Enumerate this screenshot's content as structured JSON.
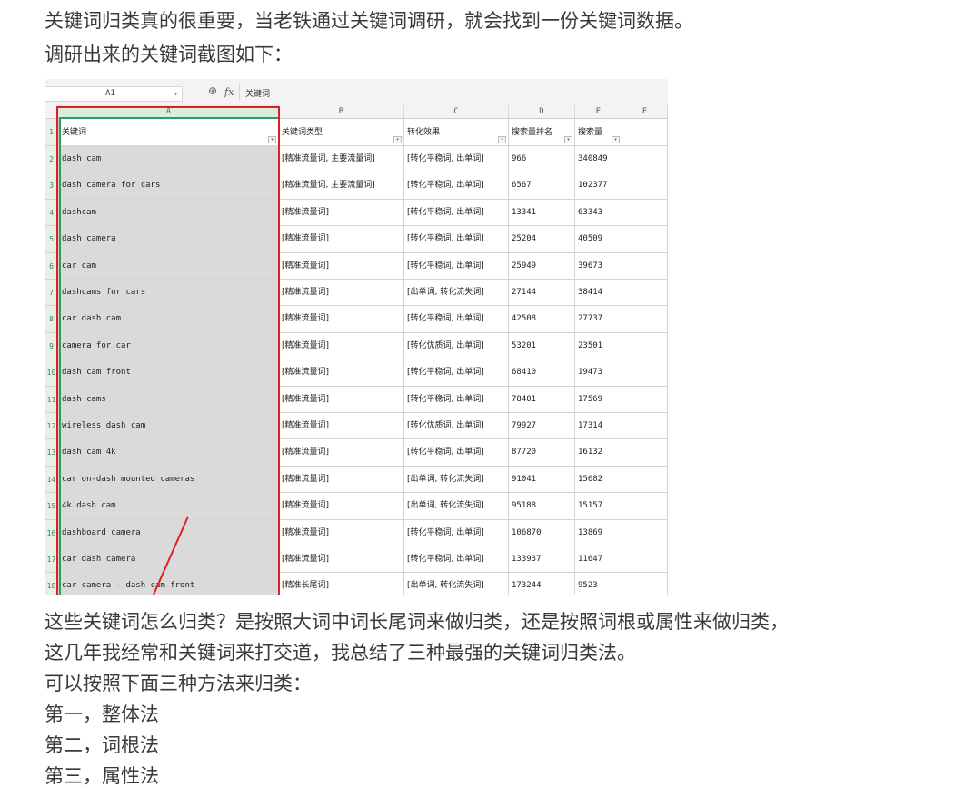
{
  "intro": {
    "line1": "关键词归类真的很重要，当老铁通过关键词调研，就会找到一份关键词数据。",
    "line2": "调研出来的关键词截图如下："
  },
  "spreadsheet": {
    "name_box": "A1",
    "fx_symbol": "fx",
    "formula_content": "关键词",
    "columns": [
      "A",
      "B",
      "C",
      "D",
      "E",
      "F"
    ],
    "headers": [
      "关键词",
      "关键词类型",
      "转化效果",
      "搜索量排名",
      "搜索量"
    ],
    "rows": [
      {
        "n": "1"
      },
      {
        "n": "2",
        "kw": "dash cam",
        "type": "[精准流量词, 主要流量词]",
        "conv": "[转化平稳词, 出单词]",
        "rank": "966",
        "vol": "340849"
      },
      {
        "n": "3",
        "kw": "dash camera for cars",
        "type": "[精准流量词, 主要流量词]",
        "conv": "[转化平稳词, 出单词]",
        "rank": "6567",
        "vol": "102377"
      },
      {
        "n": "4",
        "kw": "dashcam",
        "type": "[精准流量词]",
        "conv": "[转化平稳词, 出单词]",
        "rank": "13341",
        "vol": "63343"
      },
      {
        "n": "5",
        "kw": "dash camera",
        "type": "[精准流量词]",
        "conv": "[转化平稳词, 出单词]",
        "rank": "25204",
        "vol": "40509"
      },
      {
        "n": "6",
        "kw": "car cam",
        "type": "[精准流量词]",
        "conv": "[转化平稳词, 出单词]",
        "rank": "25949",
        "vol": "39673"
      },
      {
        "n": "7",
        "kw": "dashcams for cars",
        "type": "[精准流量词]",
        "conv": "[出单词, 转化流失词]",
        "rank": "27144",
        "vol": "38414"
      },
      {
        "n": "8",
        "kw": "car dash cam",
        "type": "[精准流量词]",
        "conv": "[转化平稳词, 出单词]",
        "rank": "42508",
        "vol": "27737"
      },
      {
        "n": "9",
        "kw": "camera for car",
        "type": "[精准流量词]",
        "conv": "[转化优质词, 出单词]",
        "rank": "53201",
        "vol": "23501"
      },
      {
        "n": "10",
        "kw": "dash cam front",
        "type": "[精准流量词]",
        "conv": "[转化平稳词, 出单词]",
        "rank": "68410",
        "vol": "19473"
      },
      {
        "n": "11",
        "kw": "dash cams",
        "type": "[精准流量词]",
        "conv": "[转化平稳词, 出单词]",
        "rank": "78401",
        "vol": "17569"
      },
      {
        "n": "12",
        "kw": "wireless dash cam",
        "type": "[精准流量词]",
        "conv": "[转化优质词, 出单词]",
        "rank": "79927",
        "vol": "17314"
      },
      {
        "n": "13",
        "kw": "dash cam 4k",
        "type": "[精准流量词]",
        "conv": "[转化平稳词, 出单词]",
        "rank": "87720",
        "vol": "16132"
      },
      {
        "n": "14",
        "kw": "car on-dash mounted cameras",
        "type": "[精准流量词]",
        "conv": "[出单词, 转化流失词]",
        "rank": "91041",
        "vol": "15682"
      },
      {
        "n": "15",
        "kw": "4k dash cam",
        "type": "[精准流量词]",
        "conv": "[出单词, 转化流失词]",
        "rank": "95188",
        "vol": "15157"
      },
      {
        "n": "16",
        "kw": "dashboard camera",
        "type": "[精准流量词]",
        "conv": "[转化平稳词, 出单词]",
        "rank": "106870",
        "vol": "13869"
      },
      {
        "n": "17",
        "kw": "car dash camera",
        "type": "[精准流量词]",
        "conv": "[转化平稳词, 出单词]",
        "rank": "133937",
        "vol": "11647"
      },
      {
        "n": "18",
        "kw": "car camera - dash cam front",
        "type": "[精准长尾词]",
        "conv": "[出单词, 转化流失词]",
        "rank": "173244",
        "vol": "9523"
      }
    ],
    "colors": {
      "selection_border": "#e02020",
      "active_column": "#2e9e5b",
      "column_a_fill": "#dadada"
    }
  },
  "body": {
    "line1": "这些关键词怎么归类？是按照大词中词长尾词来做归类，还是按照词根或属性来做归类，",
    "line2": "这几年我经常和关键词来打交道，我总结了三种最强的关键词归类法。",
    "line3": "可以按照下面三种方法来归类：",
    "method1": "第一，整体法",
    "method2": "第二，词根法",
    "method3": "第三，属性法"
  }
}
